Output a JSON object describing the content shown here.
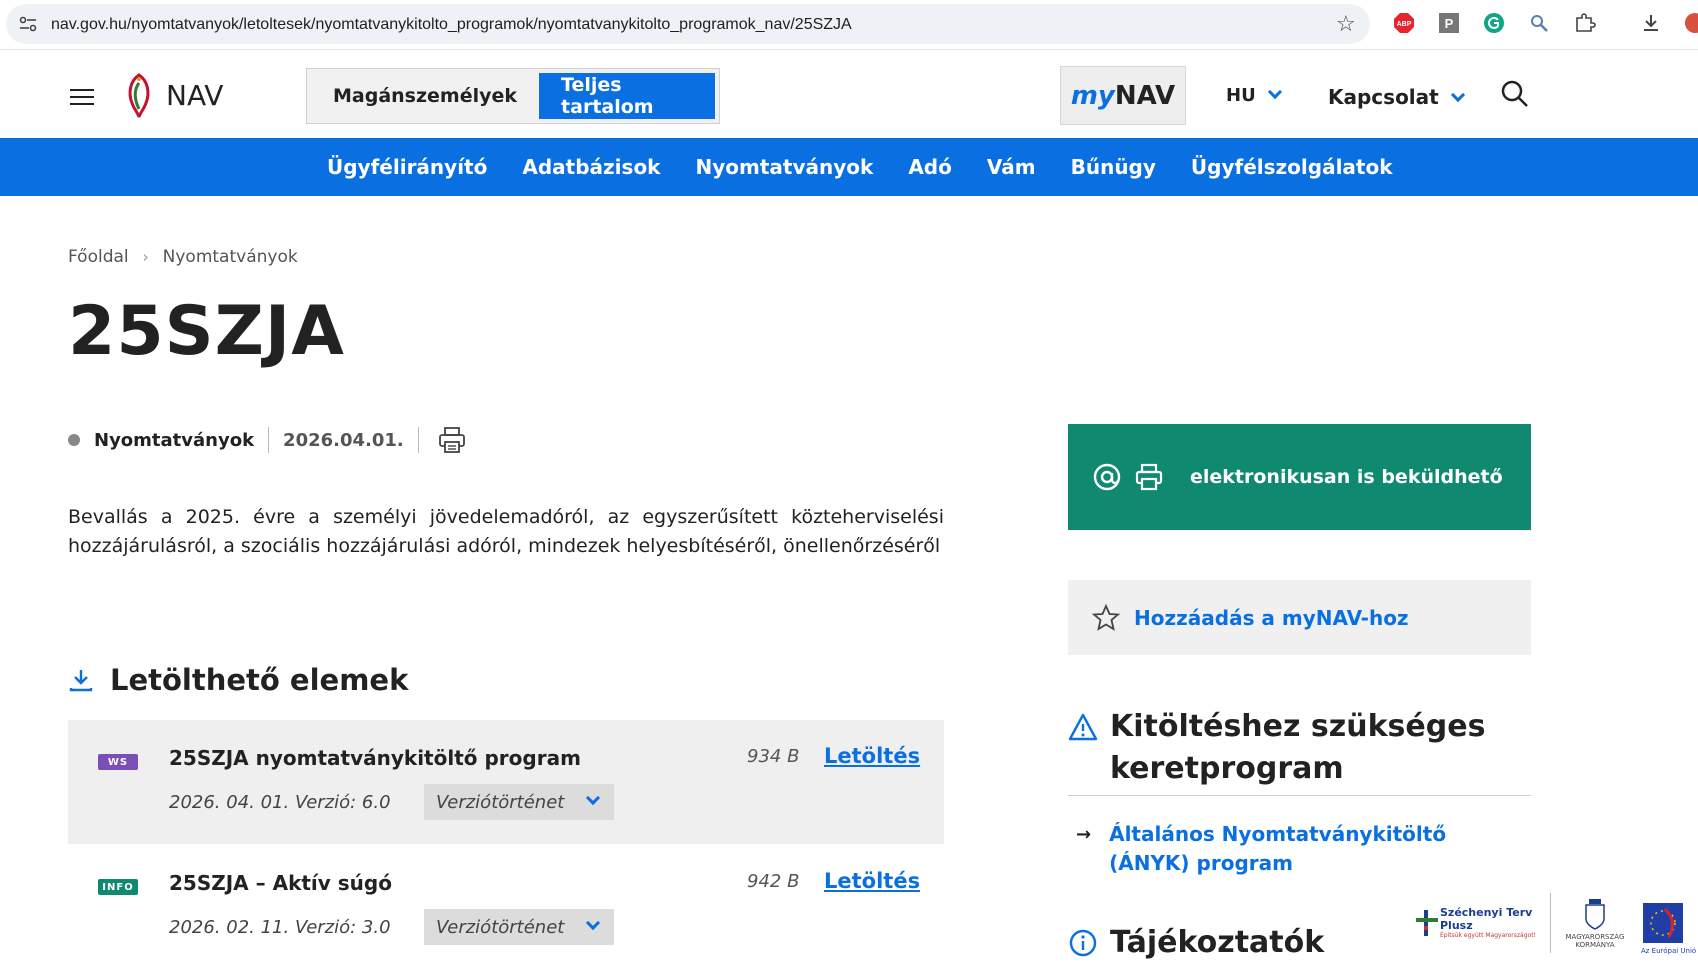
{
  "browser": {
    "url": "nav.gov.hu/nyomtatvanyok/letoltesek/nyomtatvanykitolto_programok/nyomtatvanykitolto_programok_nav/25SZJA",
    "extensions": [
      "abp-icon",
      "p-icon",
      "grammarly-icon",
      "search-ext-icon",
      "puzzle-icon",
      "download-icon",
      "profile-icon"
    ],
    "abp_label": "ABP",
    "p_label": "P"
  },
  "header": {
    "logo_text": "NAV",
    "segments": [
      {
        "label": "Magánszemélyek",
        "active": false
      },
      {
        "label": "Teljes tartalom",
        "active": true
      }
    ],
    "mynav_my": "my",
    "mynav_nav": "NAV",
    "language": "HU",
    "contact": "Kapcsolat"
  },
  "menu": [
    "Ügyfélirányító",
    "Adatbázisok",
    "Nyomtatványok",
    "Adó",
    "Vám",
    "Bűnügy",
    "Ügyfélszolgálatok"
  ],
  "breadcrumb": [
    "Főoldal",
    "Nyomtatványok"
  ],
  "breadcrumb_sep": "›",
  "page": {
    "title": "25SZJA",
    "category": "Nyomtatványok",
    "date": "2026.04.01.",
    "description": "Bevallás a 2025. évre a személyi jövedelemadóról, az egyszerűsített közteherviselési hozzájárulásról, a szociális hozzájárulási adóról, mindezek helyesbítéséről, önellenőrzéséről"
  },
  "downloads": {
    "heading": "Letölthető elemek",
    "items": [
      {
        "badge": "WS",
        "badge_color": "#7b4fb8",
        "title": "25SZJA nyomtatványkitöltő program",
        "size": "934 B",
        "link": "Letöltés",
        "date": "2026. 04. 01. Verzió: 6.0",
        "history": "Verziótörténet"
      },
      {
        "badge": "INFO",
        "badge_color": "#0f8a70",
        "title": "25SZJA – Aktív súgó",
        "size": "942 B",
        "link": "Letöltés",
        "date": "2026. 02. 11. Verzió: 3.0",
        "history": "Verziótörténet"
      }
    ]
  },
  "sidebar": {
    "electronic": "elektronikusan is beküldhető",
    "add_mynav": "Hozzáadás a myNAV-hoz",
    "framework_heading": "Kitöltéshez szükséges keretprogram",
    "framework_link": "Általános Nyomtatványkitöltő (ÁNYK) program",
    "info_heading": "Tájékoztatók"
  },
  "sponsor": {
    "szechenyi": "Széchenyi Terv",
    "plusz": "Plusz",
    "slogan": "Építsük együtt Magyarországot!",
    "kormany": "MAGYARORSZÁG KORMÁNYA",
    "eu": "Az Európai Unió társfinanszírozásával"
  },
  "colors": {
    "primary": "#0a6fe0",
    "green": "#0f8a70"
  }
}
